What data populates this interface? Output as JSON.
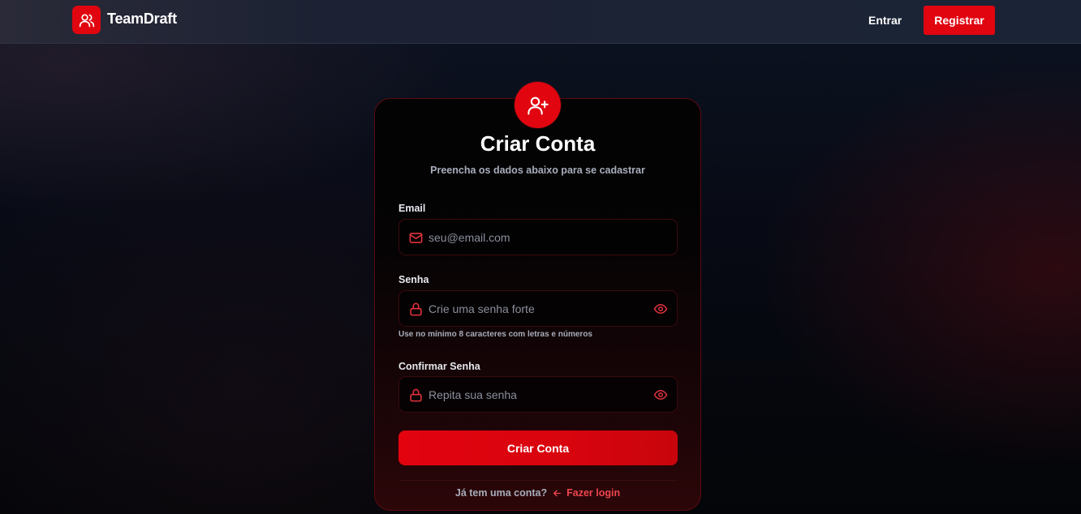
{
  "header": {
    "brand": "TeamDraft",
    "login_label": "Entrar",
    "register_label": "Registrar"
  },
  "card": {
    "title": "Criar Conta",
    "subtitle": "Preencha os dados abaixo para se cadastrar",
    "email": {
      "label": "Email",
      "placeholder": "seu@email.com",
      "value": "",
      "icon": "mail-icon"
    },
    "password": {
      "label": "Senha",
      "placeholder": "Crie uma senha forte",
      "value": "",
      "icon": "lock-icon",
      "hint": "Use no mínimo 8 caracteres com letras e números"
    },
    "confirm": {
      "label": "Confirmar Senha",
      "placeholder": "Repita sua senha",
      "value": "",
      "icon": "lock-icon"
    },
    "submit_label": "Criar Conta",
    "login_question": "Já tem uma conta?",
    "login_link": "Fazer login"
  },
  "colors": {
    "accent": "#e10510",
    "accent_link": "#f0454f",
    "muted_text": "#a7adbb"
  }
}
